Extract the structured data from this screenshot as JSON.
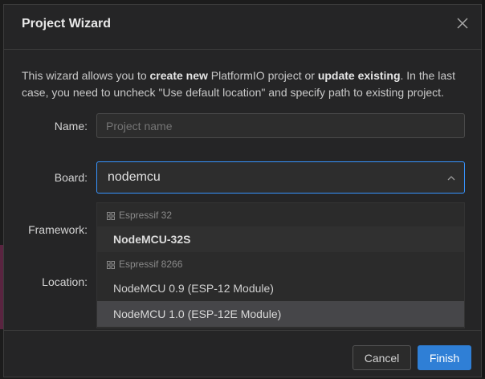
{
  "dialog": {
    "title": "Project Wizard",
    "intro": {
      "part1": "This wizard allows you to ",
      "bold1": "create new",
      "part2": " PlatformIO project or ",
      "bold2": "update existing",
      "part3": ". In the last case, you need to uncheck \"Use default location\" and specify path to existing project."
    }
  },
  "form": {
    "name_label": "Name:",
    "name_placeholder": "Project name",
    "board_label": "Board:",
    "board_value": "nodemcu",
    "framework_label": "Framework:",
    "location_label": "Location:"
  },
  "dropdown": {
    "groups": [
      {
        "name": "Espressif 32",
        "options": [
          "NodeMCU-32S"
        ]
      },
      {
        "name": "Espressif 8266",
        "options": [
          "NodeMCU 0.9 (ESP-12 Module)",
          "NodeMCU 1.0 (ESP-12E Module)"
        ]
      }
    ],
    "selected": "NodeMCU 1.0 (ESP-12E Module)"
  },
  "footer": {
    "cancel_label": "Cancel",
    "finish_label": "Finish"
  },
  "colors": {
    "accent": "#3794ff",
    "primary_button": "#2f7fd6",
    "dialog_bg": "#252526"
  }
}
